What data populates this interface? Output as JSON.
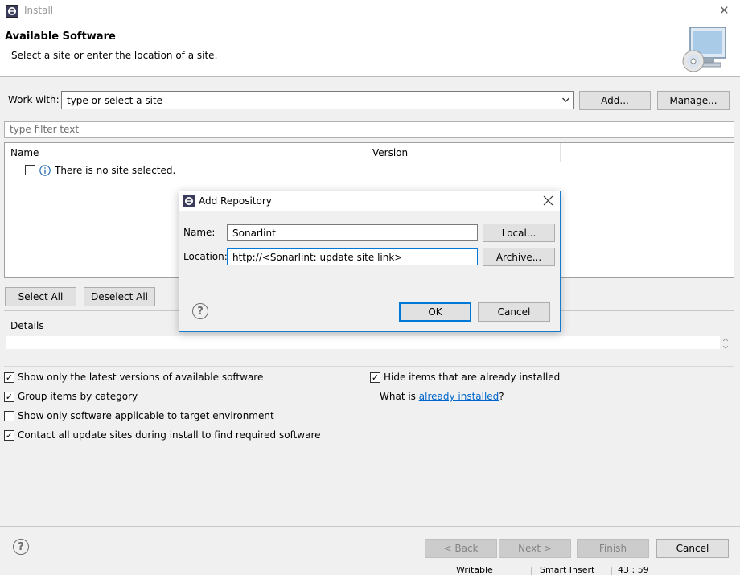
{
  "window": {
    "title": "Install",
    "close_glyph": "✕"
  },
  "header": {
    "title": "Available Software",
    "subtitle": "Select a site or enter the location of a site."
  },
  "work_with": {
    "label": "Work with:",
    "placeholder": "type or select a site",
    "add_label": "Add...",
    "manage_label": "Manage..."
  },
  "filter": {
    "placeholder": "type filter text"
  },
  "table": {
    "columns": [
      "Name",
      "Version"
    ],
    "empty_message": "There is no site selected."
  },
  "selection": {
    "select_all": "Select All",
    "deselect_all": "Deselect All"
  },
  "details": {
    "label": "Details"
  },
  "options": {
    "latest_versions": {
      "label": "Show only the latest versions of available software",
      "checked": true
    },
    "group_by_category": {
      "label": "Group items by category",
      "checked": true
    },
    "target_env": {
      "label": "Show only software applicable to target environment",
      "checked": false
    },
    "contact_sites": {
      "label": "Contact all update sites during install to find required software",
      "checked": true
    },
    "hide_installed": {
      "label": "Hide items that are already installed",
      "checked": true
    },
    "what_is_prefix": "What is ",
    "already_installed_link": "already installed",
    "what_is_suffix": "?"
  },
  "footer": {
    "back": "< Back",
    "next": "Next >",
    "finish": "Finish",
    "cancel": "Cancel"
  },
  "status_bar": {
    "writable": "Writable",
    "insert_mode": "Smart Insert",
    "position": "43 : 59"
  },
  "dialog": {
    "title": "Add Repository",
    "name_label": "Name:",
    "name_value": "Sonarlint",
    "location_label": "Location:",
    "location_value": "http://<Sonarlint: update site link>",
    "local_label": "Local...",
    "archive_label": "Archive...",
    "ok_label": "OK",
    "cancel_label": "Cancel",
    "help_glyph": "?"
  },
  "colors": {
    "accent": "#0078d7",
    "link": "#0066cc"
  }
}
